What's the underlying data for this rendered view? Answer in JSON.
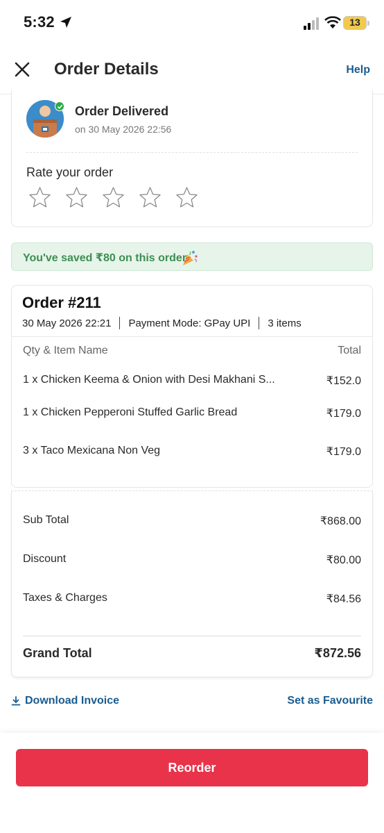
{
  "status_bar": {
    "time": "5:32",
    "battery": "13"
  },
  "header": {
    "title": "Order Details",
    "help": "Help"
  },
  "order_status": {
    "title": "Order Delivered",
    "date": "on 30 May 2026 22:56",
    "rate_title": "Rate your order",
    "rating": 0,
    "max_rating": 5
  },
  "savings": {
    "text": "You've saved ₹80 on this order"
  },
  "order": {
    "number": "Order #211",
    "date": "30 May 2026 22:21",
    "payment": "Payment Mode: GPay UPI",
    "items_count": "3 items",
    "col_item": "Qty & Item Name",
    "col_total": "Total",
    "items": [
      {
        "name": "1 x Chicken Keema & Onion with Desi Makhani S...",
        "price": "₹152.0"
      },
      {
        "name": "1 x Chicken Pepperoni Stuffed Garlic Bread",
        "price": "₹179.0"
      },
      {
        "name": "3 x Taco Mexicana Non Veg",
        "price": "₹179.0"
      }
    ]
  },
  "totals": {
    "sub_total_label": "Sub Total",
    "sub_total": "₹868.00",
    "discount_label": "Discount",
    "discount": "₹80.00",
    "taxes_label": "Taxes & Charges",
    "taxes": "₹84.56",
    "grand_total_label": "Grand Total",
    "grand_total": "₹872.56"
  },
  "actions": {
    "download": "Download Invoice",
    "favourite": "Set as Favourite"
  },
  "reorder": "Reorder",
  "colors": {
    "accent_red": "#e8334a",
    "link_blue": "#1a5c8f",
    "savings_green": "#3e8e52",
    "savings_bg": "#e6f4ea"
  }
}
